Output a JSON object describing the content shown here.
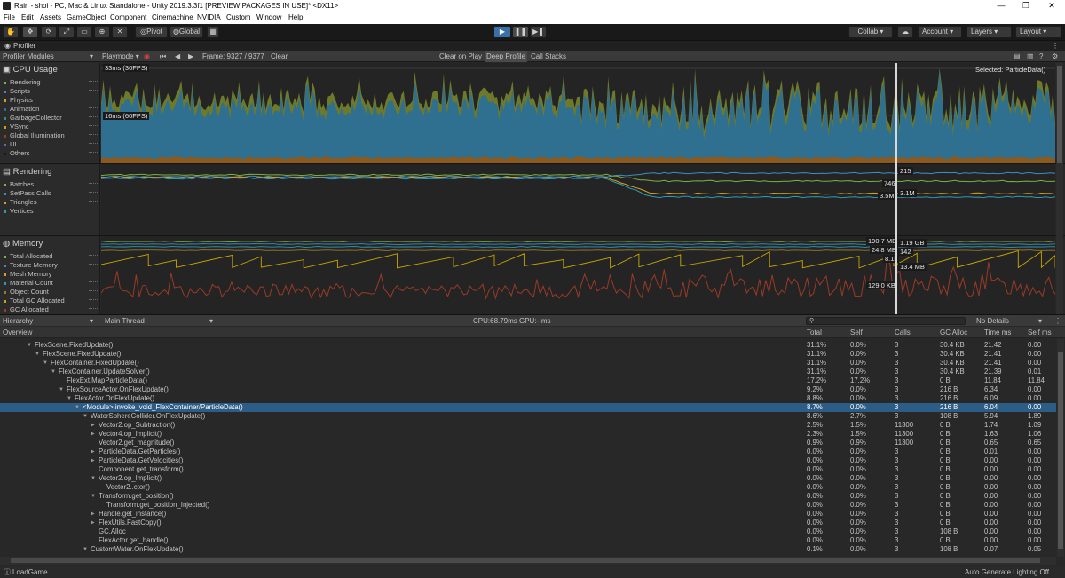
{
  "window": {
    "title": "Rain - shoi - PC, Mac & Linux Standalone - Unity 2019.3.3f1 [PREVIEW PACKAGES IN USE]* <DX11>",
    "minimize": "—",
    "maximize": "❐",
    "close": "✕"
  },
  "menu": [
    "File",
    "Edit",
    "Assets",
    "GameObject",
    "Component",
    "Cinemachine",
    "NVIDIA",
    "Custom",
    "Window",
    "Help"
  ],
  "toolbar": {
    "pivot": "Pivot",
    "global": "Global",
    "collab": "Collab ▾",
    "account": "Account",
    "layers": "Layers",
    "layout": "Layout",
    "play_icon": "▶",
    "pause_icon": "❚❚",
    "step_icon": "▶❚"
  },
  "profiler": {
    "tab": "Profiler",
    "modules_label": "Profiler Modules",
    "playmode": "Playmode",
    "frame": "Frame: 9327 / 9377",
    "clear": "Clear",
    "clear_on_play": "Clear on Play",
    "deep_profile": "Deep Profile",
    "call_stacks": "Call Stacks",
    "selected": "Selected: ParticleData()"
  },
  "cpu": {
    "title": "CPU Usage",
    "items": [
      {
        "name": "Rendering",
        "color": "#7bb344"
      },
      {
        "name": "Scripts",
        "color": "#3d8fbf"
      },
      {
        "name": "Physics",
        "color": "#d6a21e"
      },
      {
        "name": "Animation",
        "color": "#2e6f9a"
      },
      {
        "name": "GarbageCollector",
        "color": "#2f8e7a"
      },
      {
        "name": "VSync",
        "color": "#c7a600"
      },
      {
        "name": "Global Illumination",
        "color": "#9a3a26"
      },
      {
        "name": "UI",
        "color": "#5f6fa6"
      },
      {
        "name": "Others",
        "color": "#1a1a1a"
      }
    ],
    "label_30": "33ms (30FPS)",
    "label_60": "16ms (60FPS)"
  },
  "rendering": {
    "title": "Rendering",
    "items": [
      {
        "name": "Batches",
        "color": "#7bb344"
      },
      {
        "name": "SetPass Calls",
        "color": "#3d8fbf"
      },
      {
        "name": "Triangles",
        "color": "#d6a21e"
      },
      {
        "name": "Vertices",
        "color": "#2e9ab6"
      }
    ],
    "values": [
      "215",
      "746",
      "3.5M",
      "3.1M"
    ]
  },
  "memory": {
    "title": "Memory",
    "items": [
      {
        "name": "Total Allocated",
        "color": "#7bb344"
      },
      {
        "name": "Texture Memory",
        "color": "#3d8fbf"
      },
      {
        "name": "Mesh Memory",
        "color": "#d6a21e"
      },
      {
        "name": "Material Count",
        "color": "#2e9ab6"
      },
      {
        "name": "Object Count",
        "color": "#9a7a2a"
      },
      {
        "name": "Total GC Allocated",
        "color": "#c7a600"
      },
      {
        "name": "GC Allocated",
        "color": "#9a3a26"
      }
    ],
    "values": [
      "190.7 MB",
      "1.19 GB",
      "24.8 MB",
      "142",
      "8.1k",
      "13.4 MB",
      "129.0 KB"
    ]
  },
  "hierarchy": {
    "view": "Hierarchy",
    "thread": "Main Thread",
    "cpu": "CPU:68.79ms",
    "gpu": "GPU:--ms",
    "details": "No Details",
    "columns": [
      "Overview",
      "Total",
      "Self",
      "Calls",
      "GC Alloc",
      "Time ms",
      "Self ms"
    ],
    "rows": [
      {
        "name": "FlexScene.FixedUpdate()",
        "indent": 1,
        "exp": "▼",
        "total": "31.1%",
        "self": "0.0%",
        "calls": "3",
        "gc": "30.4 KB",
        "time": "21.42",
        "selfms": "0.00"
      },
      {
        "name": "FlexScene.FixedUpdate()",
        "indent": 2,
        "exp": "▼",
        "total": "31.1%",
        "self": "0.0%",
        "calls": "3",
        "gc": "30.4 KB",
        "time": "21.41",
        "selfms": "0.00"
      },
      {
        "name": "FlexContainer.FixedUpdate()",
        "indent": 3,
        "exp": "▼",
        "total": "31.1%",
        "self": "0.0%",
        "calls": "3",
        "gc": "30.4 KB",
        "time": "21.41",
        "selfms": "0.00"
      },
      {
        "name": "FlexContainer.UpdateSolver()",
        "indent": 4,
        "exp": "▼",
        "total": "31.1%",
        "self": "0.0%",
        "calls": "3",
        "gc": "30.4 KB",
        "time": "21.39",
        "selfms": "0.01"
      },
      {
        "name": "FlexExt.MapParticleData()",
        "indent": 5,
        "exp": "",
        "total": "17.2%",
        "self": "17.2%",
        "calls": "3",
        "gc": "0 B",
        "time": "11.84",
        "selfms": "11.84"
      },
      {
        "name": "FlexSourceActor.OnFlexUpdate()",
        "indent": 5,
        "exp": "▼",
        "total": "9.2%",
        "self": "0.0%",
        "calls": "3",
        "gc": "216 B",
        "time": "6.34",
        "selfms": "0.00"
      },
      {
        "name": "FlexActor.OnFlexUpdate()",
        "indent": 6,
        "exp": "▼",
        "total": "8.8%",
        "self": "0.0%",
        "calls": "3",
        "gc": "216 B",
        "time": "6.09",
        "selfms": "0.00"
      },
      {
        "name": "<Module>.invoke_void_FlexContainer/ParticleData()",
        "indent": 7,
        "exp": "▼",
        "total": "8.7%",
        "self": "0.0%",
        "calls": "3",
        "gc": "216 B",
        "time": "6.04",
        "selfms": "0.00",
        "sel": true
      },
      {
        "name": "WaterSphereCollider.OnFlexUpdate()",
        "indent": 8,
        "exp": "▼",
        "total": "8.6%",
        "self": "2.7%",
        "calls": "3",
        "gc": "108 B",
        "time": "5.94",
        "selfms": "1.89"
      },
      {
        "name": "Vector2.op_Subtraction()",
        "indent": 9,
        "exp": "▶",
        "total": "2.5%",
        "self": "1.5%",
        "calls": "11300",
        "gc": "0 B",
        "time": "1.74",
        "selfms": "1.09"
      },
      {
        "name": "Vector4.op_Implicit()",
        "indent": 9,
        "exp": "▶",
        "total": "2.3%",
        "self": "1.5%",
        "calls": "11300",
        "gc": "0 B",
        "time": "1.63",
        "selfms": "1.06"
      },
      {
        "name": "Vector2.get_magnitude()",
        "indent": 9,
        "exp": "",
        "total": "0.9%",
        "self": "0.9%",
        "calls": "11300",
        "gc": "0 B",
        "time": "0.65",
        "selfms": "0.65"
      },
      {
        "name": "ParticleData.GetParticles()",
        "indent": 9,
        "exp": "▶",
        "total": "0.0%",
        "self": "0.0%",
        "calls": "3",
        "gc": "0 B",
        "time": "0.01",
        "selfms": "0.00"
      },
      {
        "name": "ParticleData.GetVelocities()",
        "indent": 9,
        "exp": "▶",
        "total": "0.0%",
        "self": "0.0%",
        "calls": "3",
        "gc": "0 B",
        "time": "0.00",
        "selfms": "0.00"
      },
      {
        "name": "Component.get_transform()",
        "indent": 9,
        "exp": "",
        "total": "0.0%",
        "self": "0.0%",
        "calls": "3",
        "gc": "0 B",
        "time": "0.00",
        "selfms": "0.00"
      },
      {
        "name": "Vector2.op_Implicit()",
        "indent": 9,
        "exp": "▼",
        "total": "0.0%",
        "self": "0.0%",
        "calls": "3",
        "gc": "0 B",
        "time": "0.00",
        "selfms": "0.00"
      },
      {
        "name": "Vector2..ctor()",
        "indent": 10,
        "exp": "",
        "total": "0.0%",
        "self": "0.0%",
        "calls": "3",
        "gc": "0 B",
        "time": "0.00",
        "selfms": "0.00"
      },
      {
        "name": "Transform.get_position()",
        "indent": 9,
        "exp": "▼",
        "total": "0.0%",
        "self": "0.0%",
        "calls": "3",
        "gc": "0 B",
        "time": "0.00",
        "selfms": "0.00"
      },
      {
        "name": "Transform.get_position_Injected()",
        "indent": 10,
        "exp": "",
        "total": "0.0%",
        "self": "0.0%",
        "calls": "3",
        "gc": "0 B",
        "time": "0.00",
        "selfms": "0.00"
      },
      {
        "name": "Handle.get_instance()",
        "indent": 9,
        "exp": "▶",
        "total": "0.0%",
        "self": "0.0%",
        "calls": "3",
        "gc": "0 B",
        "time": "0.00",
        "selfms": "0.00"
      },
      {
        "name": "FlexUtils.FastCopy()",
        "indent": 9,
        "exp": "▶",
        "total": "0.0%",
        "self": "0.0%",
        "calls": "3",
        "gc": "0 B",
        "time": "0.00",
        "selfms": "0.00"
      },
      {
        "name": "GC.Alloc",
        "indent": 9,
        "exp": "",
        "total": "0.0%",
        "self": "0.0%",
        "calls": "3",
        "gc": "108 B",
        "time": "0.00",
        "selfms": "0.00"
      },
      {
        "name": "FlexActor.get_handle()",
        "indent": 9,
        "exp": "",
        "total": "0.0%",
        "self": "0.0%",
        "calls": "3",
        "gc": "0 B",
        "time": "0.00",
        "selfms": "0.00"
      },
      {
        "name": "CustomWater.OnFlexUpdate()",
        "indent": 8,
        "exp": "▼",
        "total": "0.1%",
        "self": "0.0%",
        "calls": "3",
        "gc": "108 B",
        "time": "0.07",
        "selfms": "0.05"
      }
    ]
  },
  "status": {
    "left": "LoadGame",
    "right": "Auto Generate Lighting Off"
  }
}
